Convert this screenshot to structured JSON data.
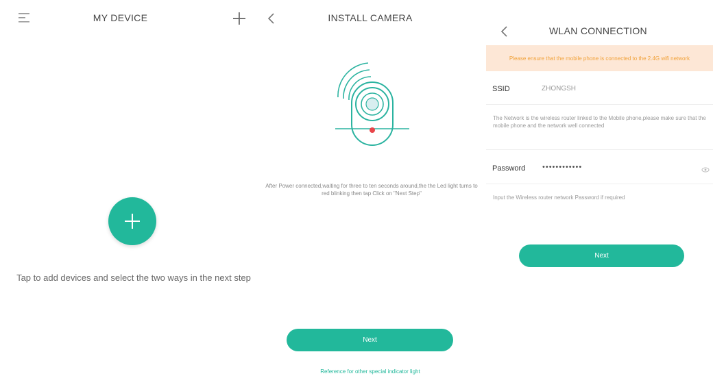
{
  "my_device": {
    "title": "MY DEVICE",
    "hint": "Tap to add devices and select the two ways in the next step"
  },
  "install_camera": {
    "title": "INSTALL CAMERA",
    "description": "After Power connected,waiting for three to ten seconds around,the the Led light turns to red blinking then tap Click on \"Next Step\"",
    "next_label": "Next",
    "reference_link": "Reference for other special indicator light"
  },
  "wlan": {
    "title": "WLAN CONNECTION",
    "warning": "Please ensure that the mobile phone is connected to the 2.4G wifi network",
    "ssid_label": "SSID",
    "ssid_value": "ZHONGSH",
    "network_note": "The Network is the wireless router linked to the Mobile phone,please make sure that the mobile phone and the network well connected",
    "password_label": "Password",
    "password_value": "••••••••••••",
    "password_note": "Input the Wireless router network Password if required",
    "next_label": "Next"
  },
  "colors": {
    "accent": "#22b89b",
    "warning_bg": "#fde7d6",
    "warning_text": "#f1a23a",
    "led": "#e8454a"
  },
  "icons": [
    "menu-icon",
    "plus-icon",
    "back-chevron-icon",
    "camera-illustration",
    "eye-icon"
  ]
}
